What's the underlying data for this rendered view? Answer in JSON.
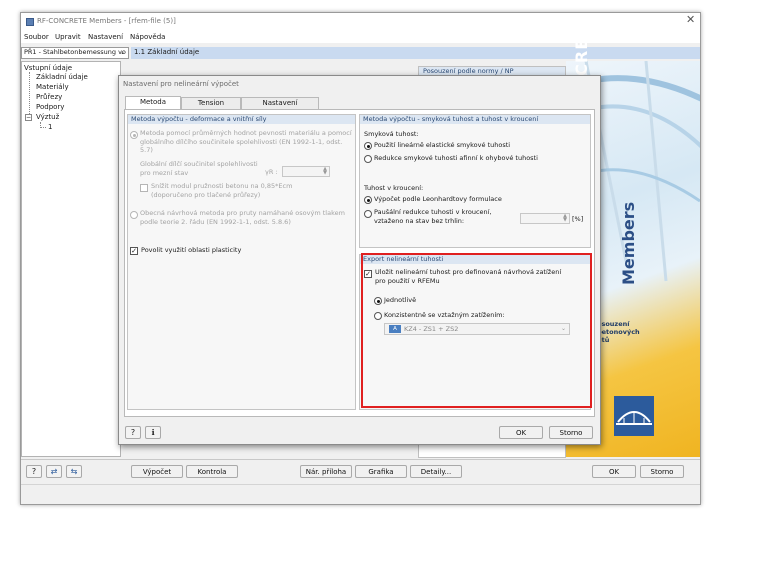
{
  "main_window": {
    "title": "RF-CONCRETE Members - [rfem-file (5)]",
    "menu": [
      "Soubor",
      "Upravit",
      "Nastavení",
      "Nápověda"
    ],
    "case_select": "PŘ1 - Stahlbetonbemessung vo",
    "panel_title": "1.1 Základní údaje",
    "tree": {
      "root": "Vstupní údaje",
      "items": [
        "Základní údaje",
        "Materiály",
        "Průřezy",
        "Podpory",
        "Výztuž"
      ],
      "sub": "1"
    },
    "right_header": "Posouzení podle normy / NP",
    "brand_big": "RF-CONCRETE",
    "brand_small": "Members",
    "brand_desc": "osouzení betonových utů",
    "bottom_buttons": {
      "calc": "Výpočet",
      "check": "Kontrola",
      "nar": "Nár. příloha",
      "graph": "Grafika",
      "details": "Detaily...",
      "ok": "OK",
      "cancel": "Storno"
    }
  },
  "dialog": {
    "title": "Nastavení pro nelineární výpočet",
    "tabs": [
      "Metoda výpočtu",
      "Tension stiffening",
      "Nastavení konvergence"
    ],
    "left_group": {
      "header": "Metoda výpočtu - deformace a vnitřní síly",
      "opt1": "Metoda pomocí průměrných hodnot pevnosti materiálu a pomocí globálního dílčího součinitele spolehlivosti (EN 1992-1-1, odst. 5.7)",
      "factor_label": "Globální dílčí součinitel spolehlivosti pro mezní stav",
      "factor_symbol": "γR :",
      "reduce_label": "Snížit modul pružnosti betonu na 0,85*Ecm (doporučeno pro tlačené průřezy)",
      "opt2": "Obecná návrhová metoda pro pruty namáhané osovým tlakem podle teorie 2. řádu (EN 1992-1-1, odst. 5.8.6)",
      "plasticity": "Povolit využití oblasti plasticity"
    },
    "right_group": {
      "header": "Metoda výpočtu - smyková tuhost a tuhost v kroucení",
      "shear_label": "Smyková tuhost:",
      "shear_opt1": "Použití lineárně elastické smykové tuhosti",
      "shear_opt2": "Redukce smykové tuhosti afinní k ohybové tuhosti",
      "torsion_label": "Tuhost v kroucení:",
      "torsion_opt1": "Výpočet podle Leonhardtovy formulace",
      "torsion_opt2": "Paušální redukce tuhosti v kroucení, vztaženo na stav bez trhlin:",
      "percent_unit": "[%]"
    },
    "export_group": {
      "header": "Export nelineární tuhosti",
      "save_label": "Uložit nelineární tuhost pro definovaná návrhová zatížení pro použití v RFEMu",
      "opt_single": "Jednotlivě",
      "opt_consistent": "Konzistentně se vztažným zatížením:",
      "combo_badge": "A",
      "combo_value": "KZ4 - ZS1 + ZS2"
    },
    "ok": "OK",
    "cancel": "Storno"
  }
}
